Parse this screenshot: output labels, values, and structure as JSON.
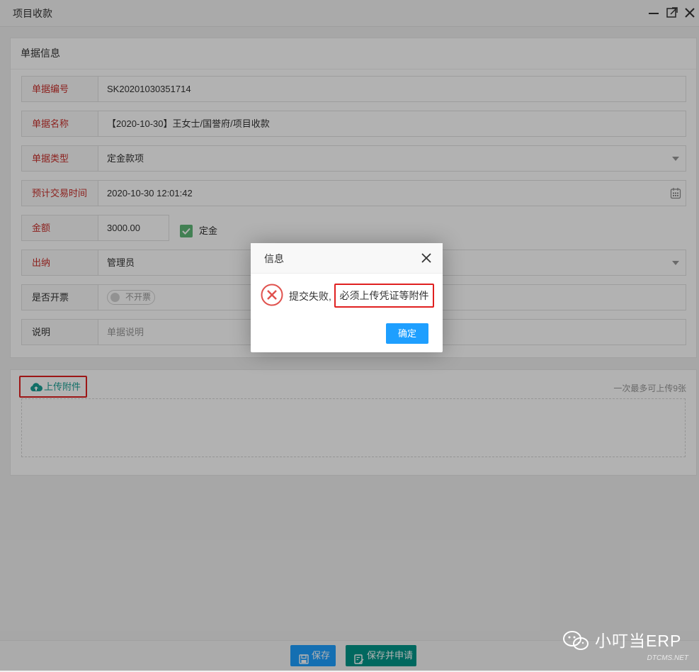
{
  "window": {
    "title": "项目收款"
  },
  "panel": {
    "title": "单据信息"
  },
  "form": {
    "doc_no": {
      "label": "单据编号",
      "value": "SK20201030351714"
    },
    "doc_name": {
      "label": "单据名称",
      "value": "【2020-10-30】王女士/国誉府/项目收款"
    },
    "doc_type": {
      "label": "单据类型",
      "value": "定金款项"
    },
    "trade_time": {
      "label": "预计交易时间",
      "value": "2020-10-30 12:01:42"
    },
    "amount": {
      "label": "金额",
      "value": "3000.00"
    },
    "deposit": {
      "label": "定金",
      "checked": true
    },
    "cashier": {
      "label": "出纳",
      "value": "管理员"
    },
    "invoice": {
      "label": "是否开票",
      "switch_text": "不开票"
    },
    "note": {
      "label": "说明",
      "placeholder": "单据说明"
    }
  },
  "upload": {
    "button_label": "上传附件",
    "hint": "一次最多可上传9张"
  },
  "footer": {
    "save_label": "保存",
    "submit_label": "保存并申请"
  },
  "dialog": {
    "title": "信息",
    "message_prefix": "提交失败,",
    "message_highlight": "必须上传凭证等附件",
    "ok_label": "确定"
  },
  "watermark": {
    "text": "小叮当ERP",
    "sub": "DTCMS.NET"
  },
  "colors": {
    "required_label": "#c9302c",
    "primary": "#1e9fff",
    "teal": "#009688",
    "check_green": "#5fb878",
    "highlight_border": "#e02020",
    "error_icon": "#e0524e"
  },
  "icons": [
    "minimize-icon",
    "maximize-icon",
    "close-icon",
    "calendar-icon",
    "check-icon",
    "cloud-upload-icon",
    "save-icon",
    "edit-icon",
    "error-icon",
    "wechat-icon"
  ]
}
